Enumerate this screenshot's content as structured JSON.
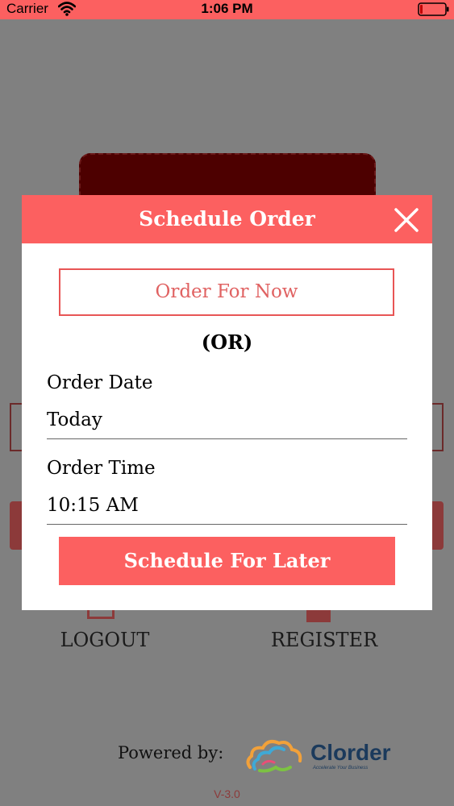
{
  "status_bar": {
    "carrier": "Carrier",
    "time": "1:06 PM"
  },
  "background": {
    "logout_label": "LOGOUT",
    "register_label": "REGISTER",
    "powered_by": "Powered by:",
    "logo_name": "Clorder",
    "logo_tagline": "Accelerate Your Business",
    "version": "V-3.0"
  },
  "modal": {
    "title": "Schedule Order",
    "order_now_label": "Order For Now",
    "or_label": "(OR)",
    "order_date": {
      "label": "Order Date",
      "value": "Today"
    },
    "order_time": {
      "label": "Order Time",
      "value": "10:15 AM"
    },
    "schedule_later_label": "Schedule For Later"
  },
  "colors": {
    "accent": "#fc6060",
    "overlay": "#808080",
    "card_dark": "#4d0000",
    "logo_blue": "#1b3a5c"
  },
  "icons": {
    "wifi": "wifi-icon",
    "battery": "battery-icon",
    "close": "close-icon",
    "logo": "clorder-logo"
  }
}
